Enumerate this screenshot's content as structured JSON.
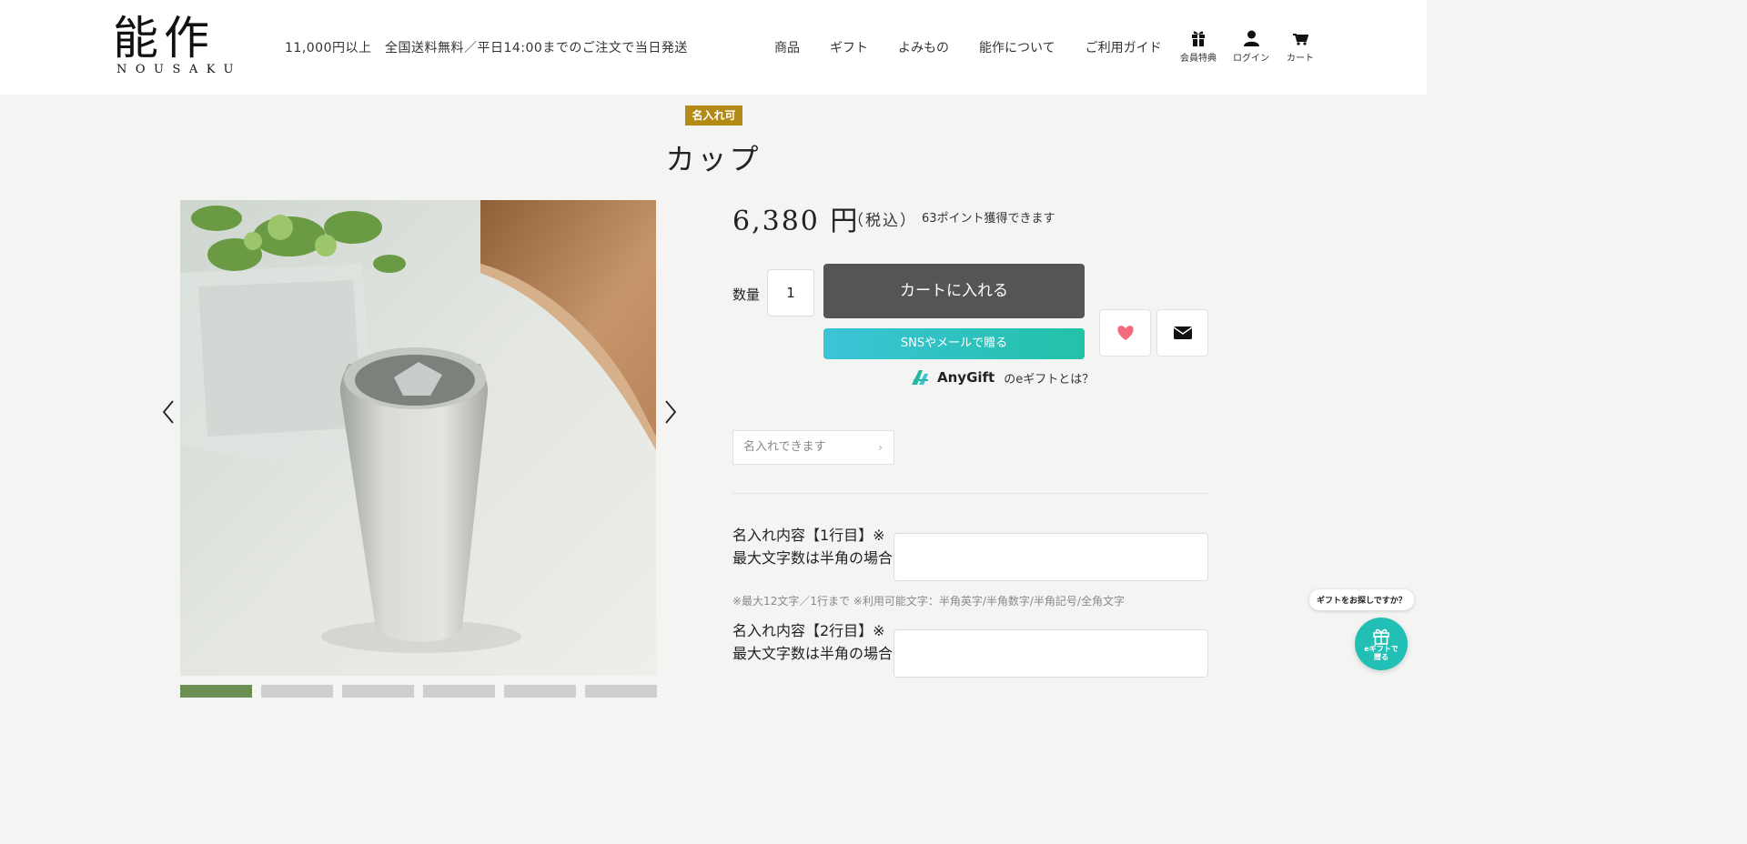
{
  "header": {
    "logo_kanji": "能作",
    "logo_roman": "NOUSAKU",
    "shipping_text": "11,000円以上　全国送料無料／平日14:00までのご注文で当日発送",
    "nav": [
      "商品",
      "ギフト",
      "よみもの",
      "能作について",
      "ご利用ガイド"
    ],
    "utility": {
      "member": "会員特典",
      "login": "ログイン",
      "cart": "カート"
    }
  },
  "product": {
    "badge": "名入れ可",
    "title": "カップ",
    "price": "6,380 円",
    "tax_note": "（税込）",
    "points": "63ポイント獲得できます",
    "quantity_label": "数量",
    "quantity_value": "1",
    "add_to_cart": "カートに入れる",
    "sns_gift": "SNSやメールで贈る",
    "anygift_brand": "AnyGift",
    "anygift_link": "のeギフトとは？",
    "engrave_link": "名入れできます",
    "engrave_fields": [
      {
        "label": "名入れ内容【1行目】※最大文字数は半角の場合"
      },
      {
        "label": "名入れ内容【2行目】※最大文字数は半角の場合"
      }
    ],
    "engrave_note": "※最大12文字／1行まで ※利用可能文字：半角英字/半角数字/半角記号/全角文字"
  },
  "gift_widget": {
    "bubble": "ギフトをお探しですか？",
    "button_line1": "eギフトで",
    "button_line2": "贈る"
  },
  "colors": {
    "badge": "#b48a17",
    "cart_button": "#555555",
    "sns_gradient_start": "#3cc3d8",
    "sns_gradient_end": "#22c2a8",
    "heart": "#f26b7d",
    "gift_widget": "#22c0b4"
  }
}
